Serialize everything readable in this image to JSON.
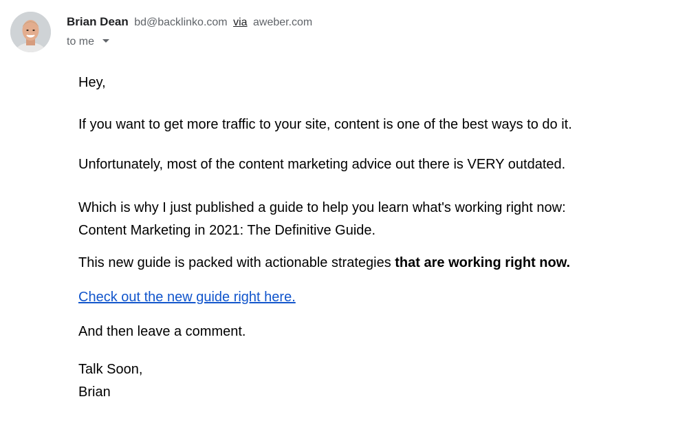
{
  "sender": {
    "name": "Brian Dean",
    "email": "bd@backlinko.com",
    "via_label": "via",
    "via_domain": "aweber.com"
  },
  "recipient": {
    "label": "to me"
  },
  "icons": {
    "avatar": "sender-avatar-photo",
    "recipient_dropdown": "chevron-down-icon"
  },
  "colors": {
    "link": "#1155cc",
    "muted_text": "#5f6368",
    "body_text": "#000000"
  },
  "message": {
    "greeting": "Hey,",
    "paragraph_1": "If you want to get more traffic to your site, content is one of the best ways to do it.",
    "paragraph_2": "Unfortunately, most of the content marketing advice out there is VERY outdated.",
    "paragraph_3_line_1": "Which is why I just published a guide to help you learn what's working right now:",
    "paragraph_3_line_2": "Content Marketing in 2021: The Definitive Guide.",
    "paragraph_4_regular": "This new guide is packed with actionable strategies ",
    "paragraph_4_bold": "that are working right now.",
    "cta_link": "Check out the new guide right here.",
    "paragraph_5": "And then leave a comment.",
    "signoff": "Talk Soon,",
    "signature": "Brian"
  }
}
